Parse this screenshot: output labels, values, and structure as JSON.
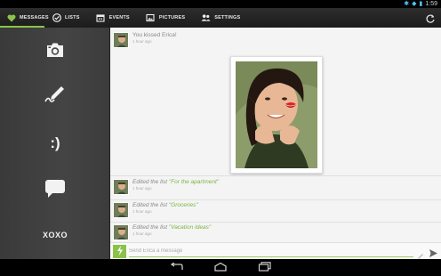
{
  "status_bar": {
    "time": "1:59",
    "icons": [
      "bluetooth-icon",
      "wifi-icon",
      "battery-icon"
    ]
  },
  "nav": {
    "tabs": [
      {
        "label": "MESSAGES",
        "icon": "heart-icon",
        "active": true
      },
      {
        "label": "LISTS",
        "icon": "checkmark-icon",
        "active": false
      },
      {
        "label": "EVENTS",
        "icon": "calendar-icon",
        "active": false
      },
      {
        "label": "PICTURES",
        "icon": "picture-icon",
        "active": false
      },
      {
        "label": "SETTINGS",
        "icon": "people-icon",
        "active": false
      }
    ],
    "refresh_icon": "refresh-icon",
    "accent_color": "#8bc34a"
  },
  "sidebar": {
    "items": [
      {
        "name": "camera",
        "icon": "camera-icon"
      },
      {
        "name": "draw",
        "icon": "pen-icon"
      },
      {
        "name": "smiley",
        "icon": "smiley-icon",
        "text": ":)"
      },
      {
        "name": "bubble",
        "icon": "speech-bubble-icon"
      },
      {
        "name": "xoxo",
        "text": "XOXO"
      }
    ]
  },
  "feed": {
    "entries": [
      {
        "message": "You kissed Erica!",
        "time": "1 hour ago"
      },
      {
        "prefix": "Edited the list ",
        "list_name": "\"For the apartment\"",
        "time": "1 hour ago"
      },
      {
        "prefix": "Edited the list ",
        "list_name": "\"Groceries\"",
        "time": "1 hour ago"
      },
      {
        "prefix": "Edited the list ",
        "list_name": "\"Vacation Ideas\"",
        "time": "1 hour ago"
      }
    ]
  },
  "composer": {
    "placeholder": "Send Erica a message"
  }
}
